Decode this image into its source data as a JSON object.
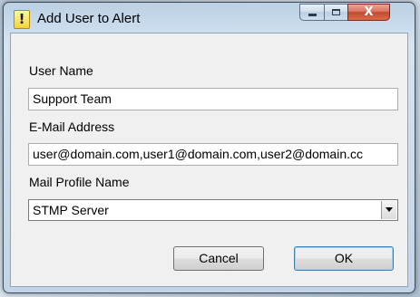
{
  "window": {
    "title": "Add User to Alert",
    "title_icon": "!",
    "close_glyph": "X"
  },
  "form": {
    "user_name_label": "User Name",
    "user_name_value": "Support Team",
    "email_label": "E-Mail Address",
    "email_value": "user@domain.com,user1@domain.com,user2@domain.cc",
    "profile_label": "Mail Profile Name",
    "profile_value": "STMP Server"
  },
  "buttons": {
    "cancel_label": "Cancel",
    "ok_label": "OK"
  },
  "colors": {
    "client_background": "#f0f0f0",
    "close_button": "#c24a31",
    "default_button_border": "#3c7fb1"
  }
}
